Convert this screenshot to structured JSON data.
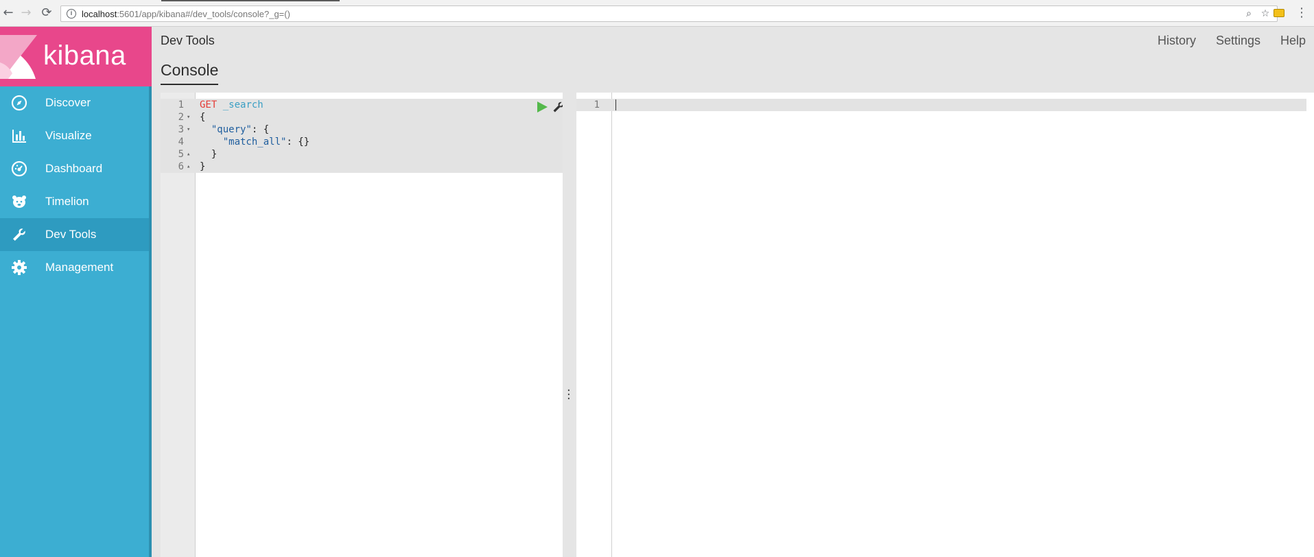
{
  "browser": {
    "url_host": "localhost",
    "url_path": ":5601/app/kibana#/dev_tools/console?_g=()",
    "back_icon": "arrow-left-icon",
    "forward_icon": "arrow-right-icon",
    "reload_icon": "reload-icon",
    "zoom_icon": "magnifier-icon",
    "star_icon": "star-icon",
    "extension_icon": "extension-icon",
    "menu_icon": "vertical-dots-icon"
  },
  "logo": {
    "text": "kibana"
  },
  "sidebar": {
    "items": [
      {
        "label": "Discover",
        "icon": "compass-icon",
        "active": false
      },
      {
        "label": "Visualize",
        "icon": "bar-chart-icon",
        "active": false
      },
      {
        "label": "Dashboard",
        "icon": "dashboard-icon",
        "active": false
      },
      {
        "label": "Timelion",
        "icon": "timelion-icon",
        "active": false
      },
      {
        "label": "Dev Tools",
        "icon": "wrench-icon",
        "active": true
      },
      {
        "label": "Management",
        "icon": "gear-icon",
        "active": false
      }
    ]
  },
  "header": {
    "title": "Dev Tools",
    "links": {
      "history": "History",
      "settings": "Settings",
      "help": "Help"
    },
    "tab": "Console"
  },
  "editor": {
    "lines": [
      {
        "num": "1",
        "fold": "",
        "method": "GET",
        "url": "_search"
      },
      {
        "num": "2",
        "fold": "▾",
        "text": "{"
      },
      {
        "num": "3",
        "fold": "▾",
        "indent": "  ",
        "key": "\"query\"",
        "rest": ": {"
      },
      {
        "num": "4",
        "fold": "",
        "indent": "    ",
        "key": "\"match_all\"",
        "rest": ": {}"
      },
      {
        "num": "5",
        "fold": "▴",
        "text": "  }"
      },
      {
        "num": "6",
        "fold": "▴",
        "text": "}"
      }
    ]
  },
  "output": {
    "line_num": "1"
  },
  "colors": {
    "sidebar": "#3caed2",
    "logo": "#e8478b",
    "method": "#e53a35",
    "url": "#3a9fc4",
    "run": "#54b94b"
  }
}
